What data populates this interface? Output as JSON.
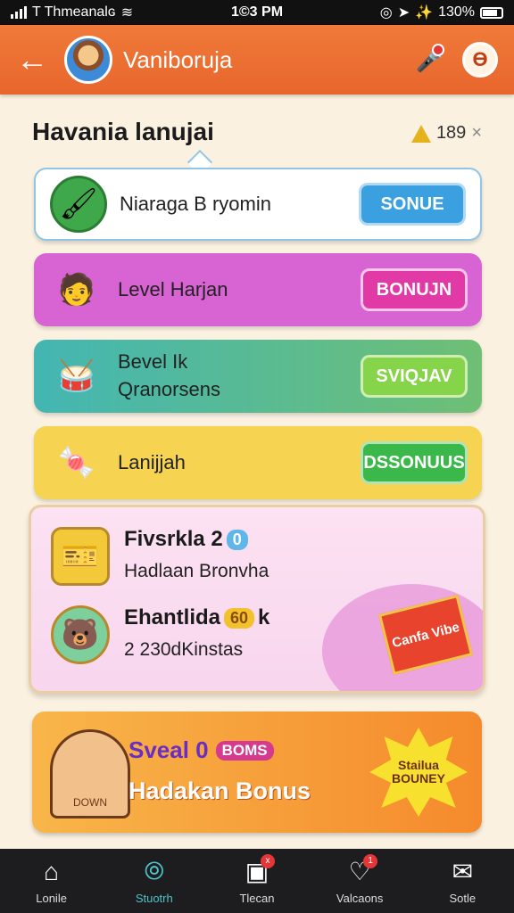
{
  "status_bar": {
    "carrier": "T Thmeanalɢ",
    "time": "1©3 PM",
    "battery": "130%"
  },
  "header": {
    "title": "Vaniboruja"
  },
  "section": {
    "title": "Havania lanujai",
    "balance": "189"
  },
  "cards": [
    {
      "label": "Niaraga B ryomin",
      "button": "SONUE"
    },
    {
      "label": "Level Harjan",
      "button": "BONUJN"
    },
    {
      "label": "Bevel Ik\nQranorsens",
      "button": "SVIQJAV"
    },
    {
      "label": "Lanijjah",
      "button": "DSSONUUS"
    }
  ],
  "pink_panel": {
    "row1": {
      "title": "Fivsrkla 2",
      "badge": "0",
      "subtitle": "Hadlaan Bronvha"
    },
    "row2": {
      "title": "Ehantlida",
      "badge": "60",
      "suffix": "k",
      "subtitle": "2 230dKinstas"
    },
    "ticket": "Canfa Vibe"
  },
  "promo": {
    "line1": "Sveal 0",
    "line1_badge": "BOMS",
    "line2": "Hadakan Bonus",
    "sign": "DOWN",
    "burst": "Stailua\nBOUNEY"
  },
  "bottom_nav": [
    {
      "label": "Lonile",
      "icon": "home-icon"
    },
    {
      "label": "Stuotrh",
      "icon": "swirl-icon"
    },
    {
      "label": "Tlecan",
      "icon": "chat-icon",
      "badge": "x"
    },
    {
      "label": "Valcaons",
      "icon": "heart-icon",
      "badge": "1"
    },
    {
      "label": "Sotle",
      "icon": "mail-icon"
    }
  ],
  "colors": {
    "header": "#e8662c",
    "accent_blue": "#3ba0e0",
    "accent_pink": "#e13aa6",
    "accent_green": "#3ab84a",
    "nav_active": "#4fc3c8"
  }
}
